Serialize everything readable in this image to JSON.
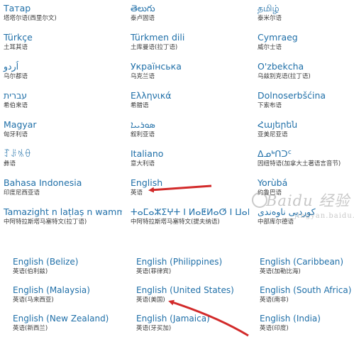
{
  "top_languages": [
    {
      "native": "Татар",
      "cn": "塔塔尔语(西里尔文)"
    },
    {
      "native": "తెలుగు",
      "cn": "泰卢固语"
    },
    {
      "native": "தமிழ்",
      "cn": "泰米尔语"
    },
    {
      "native": "Türkçe",
      "cn": "土耳其语"
    },
    {
      "native": "Türkmen dili",
      "cn": "土库曼语(拉丁语)"
    },
    {
      "native": "Cymraeg",
      "cn": "威尔士语"
    },
    {
      "native": "اُردو",
      "cn": "乌尔都语"
    },
    {
      "native": "Українська",
      "cn": "乌克兰语"
    },
    {
      "native": "O'zbekcha",
      "cn": "乌兹别克语(拉丁语)"
    },
    {
      "native": "עברית",
      "cn": "希伯来语"
    },
    {
      "native": "Ελληνικά",
      "cn": "希腊语"
    },
    {
      "native": "Dolnoserbšćina",
      "cn": "下索布语"
    },
    {
      "native": "Magyar",
      "cn": "匈牙利语"
    },
    {
      "native": "ܣܘܪܝܝܐ",
      "cn": "叙利亚语"
    },
    {
      "native": "Հայերեն",
      "cn": "亚美尼亚语"
    },
    {
      "native": "ꆈꌠꁱꂷ",
      "cn": "彝语"
    },
    {
      "native": "Italiano",
      "cn": "意大利语"
    },
    {
      "native": "ᐃᓄᒃᑎᑐᑦ",
      "cn": "因纽特语(加拿大土著语言音节)"
    },
    {
      "native": "Bahasa Indonesia",
      "cn": "印度尼西亚语"
    },
    {
      "native": "English",
      "cn": "英语"
    },
    {
      "native": "Yorùbá",
      "cn": "约鲁巴语"
    },
    {
      "native": "Tamazight n laṭlaṣ n wamm...",
      "cn": "中阿特拉斯塔马塞特文(拉丁语)"
    },
    {
      "native": "ⵜⴰⵎⴰⵣⵉⵖⵜ ⵏ ⵍⴰⵟⵍⴰⵚ ⵏ ⵡⴰⵎⵎⴰⵙ",
      "cn": "中阿特拉斯塔马塞特文(提夫纳语)"
    },
    {
      "native": "کوردیی ناوەندی",
      "cn": "中部库尔德语"
    }
  ],
  "english_variants": [
    {
      "native": "English (Belize)",
      "cn": "英语(伯利兹)"
    },
    {
      "native": "English (Philippines)",
      "cn": "英语(菲律宾)"
    },
    {
      "native": "English (Caribbean)",
      "cn": "英语(加勒比海)"
    },
    {
      "native": "English (Malaysia)",
      "cn": "英语(马来西亚)"
    },
    {
      "native": "English (United States)",
      "cn": "英语(美国)"
    },
    {
      "native": "English (South Africa)",
      "cn": "英语(南非)"
    },
    {
      "native": "English (New Zealand)",
      "cn": "英语(新西兰)"
    },
    {
      "native": "English (Jamaica)",
      "cn": "英语(牙买加)"
    },
    {
      "native": "English (India)",
      "cn": "英语(印度)"
    }
  ],
  "watermark": {
    "text": "Baidu 经验",
    "subtext": "jingyan.baidu.com"
  },
  "colors": {
    "link": "#1f6fa8",
    "sub": "#3a3a3a",
    "arrow": "#d22a2a"
  }
}
